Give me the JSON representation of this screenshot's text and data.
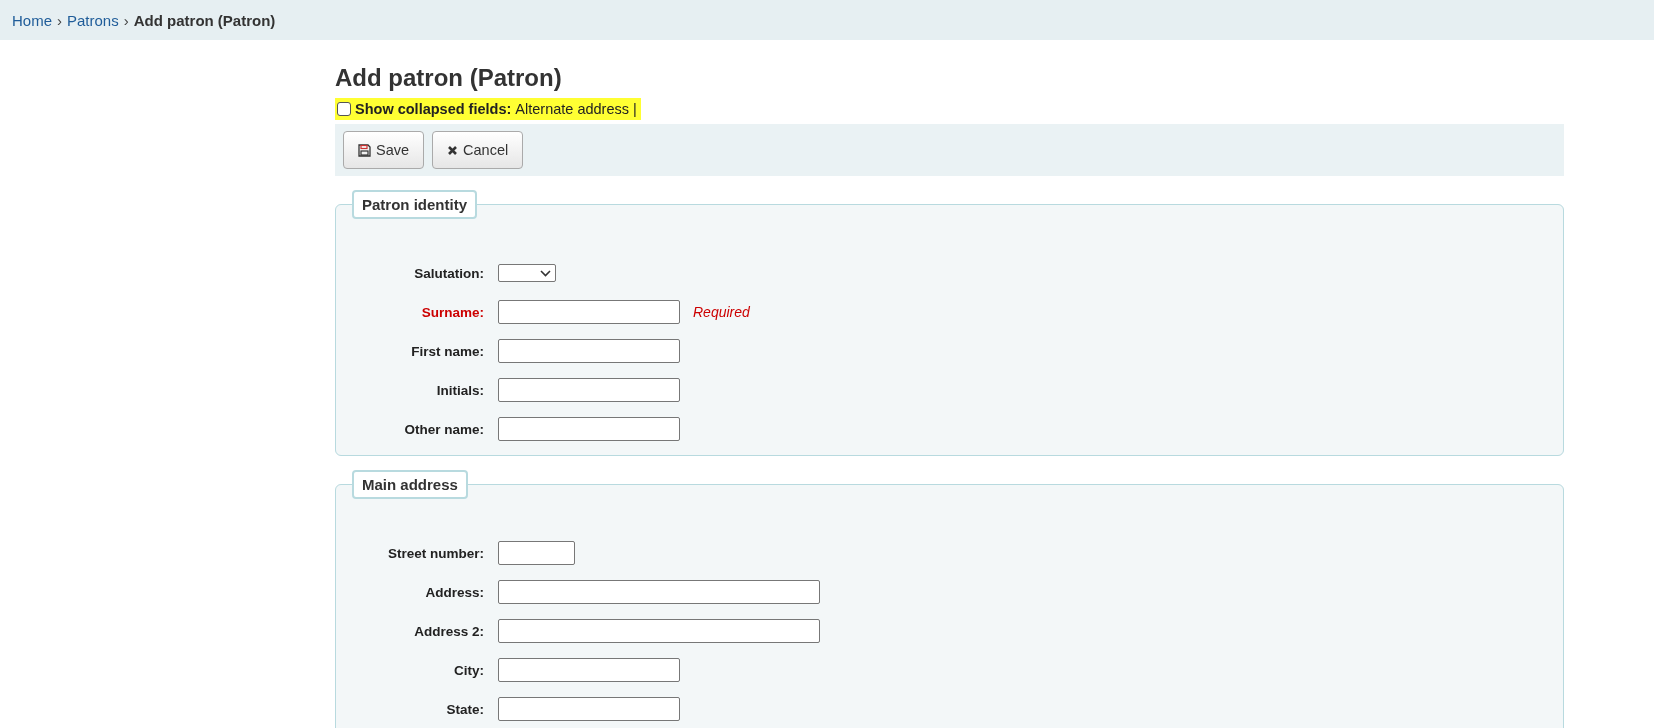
{
  "breadcrumbs": [
    {
      "label": "Home",
      "current": false
    },
    {
      "label": "Patrons",
      "current": false
    },
    {
      "label": "Add patron (Patron)",
      "current": true
    }
  ],
  "breadcrumb_separator": "›",
  "title": "Add patron (Patron)",
  "collapsed_toggle": {
    "checked": false,
    "label": "Show collapsed fields:",
    "options": [
      "Alternate address |"
    ]
  },
  "toolbar": [
    {
      "kind": "save",
      "label": "Save"
    },
    {
      "kind": "cancel",
      "label": "Cancel"
    }
  ],
  "fieldsets": [
    {
      "legend": "Patron identity",
      "fields": [
        {
          "label": "Salutation:",
          "kind": "select",
          "required": false
        },
        {
          "label": "Surname:",
          "kind": "text",
          "required": true,
          "note": "Required"
        },
        {
          "label": "First name:",
          "kind": "text",
          "required": false
        },
        {
          "label": "Initials:",
          "kind": "text",
          "required": false
        },
        {
          "label": "Other name:",
          "kind": "text",
          "required": false
        }
      ]
    },
    {
      "legend": "Main address",
      "fields": [
        {
          "label": "Street number:",
          "kind": "short-text",
          "required": false
        },
        {
          "label": "Address:",
          "kind": "long-text",
          "required": false
        },
        {
          "label": "Address 2:",
          "kind": "long-text",
          "required": false
        },
        {
          "label": "City:",
          "kind": "text",
          "required": false
        },
        {
          "label": "State:",
          "kind": "text",
          "required": false
        }
      ]
    }
  ]
}
